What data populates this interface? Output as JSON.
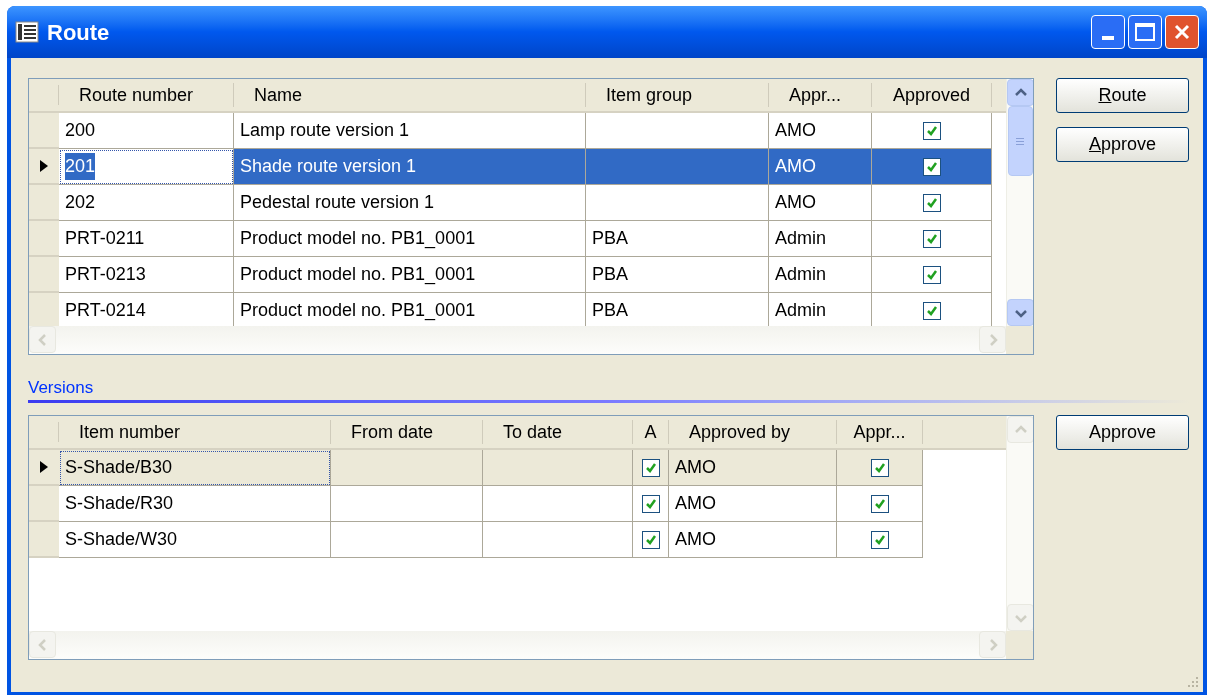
{
  "window": {
    "title": "Route"
  },
  "grids": [
    {
      "focused": true,
      "scroll_disabled": false,
      "columns": [
        {
          "label": "Route number",
          "kind": "text"
        },
        {
          "label": "Name",
          "kind": "text"
        },
        {
          "label": "Item group",
          "kind": "text"
        },
        {
          "label": "Appr...",
          "kind": "text"
        },
        {
          "label": "Approved",
          "kind": "check"
        }
      ],
      "rows": [
        {
          "selected": false,
          "cells": [
            "200",
            "Lamp route version 1",
            null,
            "AMO",
            true
          ]
        },
        {
          "selected": true,
          "cells": [
            "201",
            "Shade route version 1",
            null,
            "AMO",
            true
          ]
        },
        {
          "selected": false,
          "cells": [
            "202",
            "Pedestal route version 1",
            null,
            "AMO",
            true
          ]
        },
        {
          "selected": false,
          "cells": [
            "PRT-0211",
            "Product model no. PB1_0001",
            "PBA",
            "Admin",
            true
          ]
        },
        {
          "selected": false,
          "cells": [
            "PRT-0213",
            "Product model no. PB1_0001",
            "PBA",
            "Admin",
            true
          ]
        },
        {
          "selected": false,
          "cells": [
            "PRT-0214",
            "Product model no. PB1_0001",
            "PBA",
            "Admin",
            true
          ]
        }
      ],
      "buttons": [
        {
          "label": "Route",
          "underline_first": true
        },
        {
          "label": "Approve",
          "underline_first": true
        }
      ]
    },
    {
      "focused": false,
      "scroll_disabled": true,
      "link": "Versions",
      "columns": [
        {
          "label": "Item number",
          "kind": "text"
        },
        {
          "label": "From date",
          "kind": "text"
        },
        {
          "label": "To date",
          "kind": "text"
        },
        {
          "label": "A",
          "kind": "check"
        },
        {
          "label": "Approved by",
          "kind": "text"
        },
        {
          "label": "Appr...",
          "kind": "check"
        }
      ],
      "rows": [
        {
          "selected": true,
          "cells": [
            "S-Shade/B30",
            null,
            null,
            true,
            "AMO",
            true
          ]
        },
        {
          "selected": false,
          "cells": [
            "S-Shade/R30",
            null,
            null,
            true,
            "AMO",
            true
          ]
        },
        {
          "selected": false,
          "cells": [
            "S-Shade/W30",
            null,
            null,
            true,
            "AMO",
            true
          ]
        }
      ],
      "buttons": [
        {
          "label": "Approve",
          "underline_first": false
        }
      ]
    }
  ]
}
